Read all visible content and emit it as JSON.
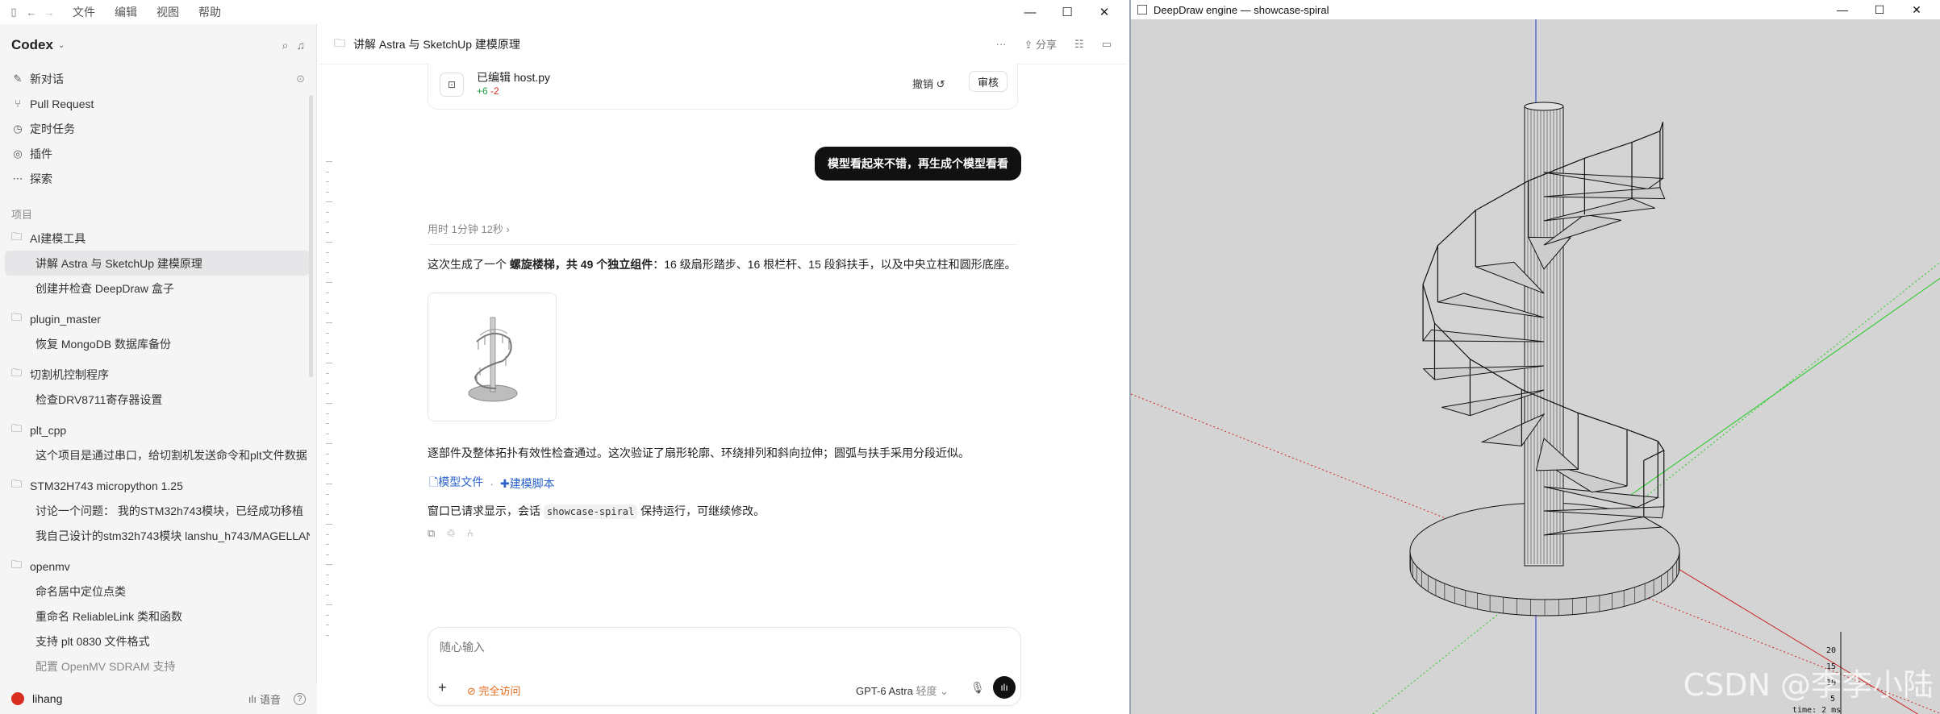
{
  "menu": {
    "file": "文件",
    "edit": "编辑",
    "view": "视图",
    "help": "帮助"
  },
  "sidebar": {
    "brand": "Codex",
    "nav": [
      {
        "label": "新对话",
        "icon": "new-chat-icon"
      },
      {
        "label": "Pull Request",
        "icon": "pull-request-icon"
      },
      {
        "label": "定时任务",
        "icon": "clock-icon"
      },
      {
        "label": "插件",
        "icon": "plugin-icon"
      },
      {
        "label": "探索",
        "icon": "more-icon"
      }
    ],
    "section_label": "项目",
    "projects": [
      {
        "name": "AI建模工具",
        "threads": [
          "讲解 Astra 与 SketchUp 建模原理",
          "创建并检查 DeepDraw 盒子"
        ]
      },
      {
        "name": "plugin_master",
        "threads": [
          "恢复 MongoDB 数据库备份"
        ]
      },
      {
        "name": "切割机控制程序",
        "threads": [
          "检查DRV8711寄存器设置"
        ]
      },
      {
        "name": "plt_cpp",
        "threads": [
          "这个项目是通过串口，给切割机发送命令和plt文件数据"
        ]
      },
      {
        "name": "STM32H743 micropython 1.25",
        "threads": [
          "讨论一个问题： 我的STM32h743模块，已经成功移植",
          "我自己设计的stm32h743模块 lanshu_h743/MAGELLAN"
        ]
      },
      {
        "name": "openmv",
        "threads": [
          "命名居中定位点类",
          "重命名 ReliableLink 类和函数",
          "支持 plt 0830 文件格式",
          "配置 OpenMV SDRAM 支持"
        ]
      }
    ],
    "user": "lihang",
    "voice": "语音"
  },
  "chat": {
    "title": "讲解 Astra 与 SketchUp 建模原理",
    "share": "分享",
    "card": {
      "title": "已编辑 host.py",
      "added": "+6",
      "removed": "-2",
      "undo": "撤销",
      "review": "审核"
    },
    "user_message": "模型看起来不错，再生成个模型看看",
    "elapsed": "用时 1分钟 12秒",
    "para1_pre": "这次生成了一个",
    "para1_bold": "螺旋楼梯，共 49 个独立组件",
    "para1_post": "：16 级扇形踏步、16 根栏杆、15 段斜扶手，以及中央立柱和圆形底座。",
    "para2": "逐部件及整体拓扑有效性检查通过。这次验证了扇形轮廓、环绕排列和斜向拉伸；圆弧与扶手采用分段近似。",
    "link_model": "模型文件",
    "link_sep": "·",
    "link_script": "建模脚本",
    "para3_pre": "窗口已请求显示，会话",
    "para3_code": "showcase-spiral",
    "para3_post": "保持运行，可继续修改。"
  },
  "composer": {
    "placeholder": "随心输入",
    "access": "完全访问",
    "model": "GPT-6 Astra",
    "model_sub": "轻度"
  },
  "viewer": {
    "title": "DeepDraw engine — showcase-spiral",
    "axis_labels": [
      "20",
      "15",
      "10",
      "5"
    ],
    "time": "time: 2 ms",
    "watermark": "CSDN @李李小陆"
  }
}
